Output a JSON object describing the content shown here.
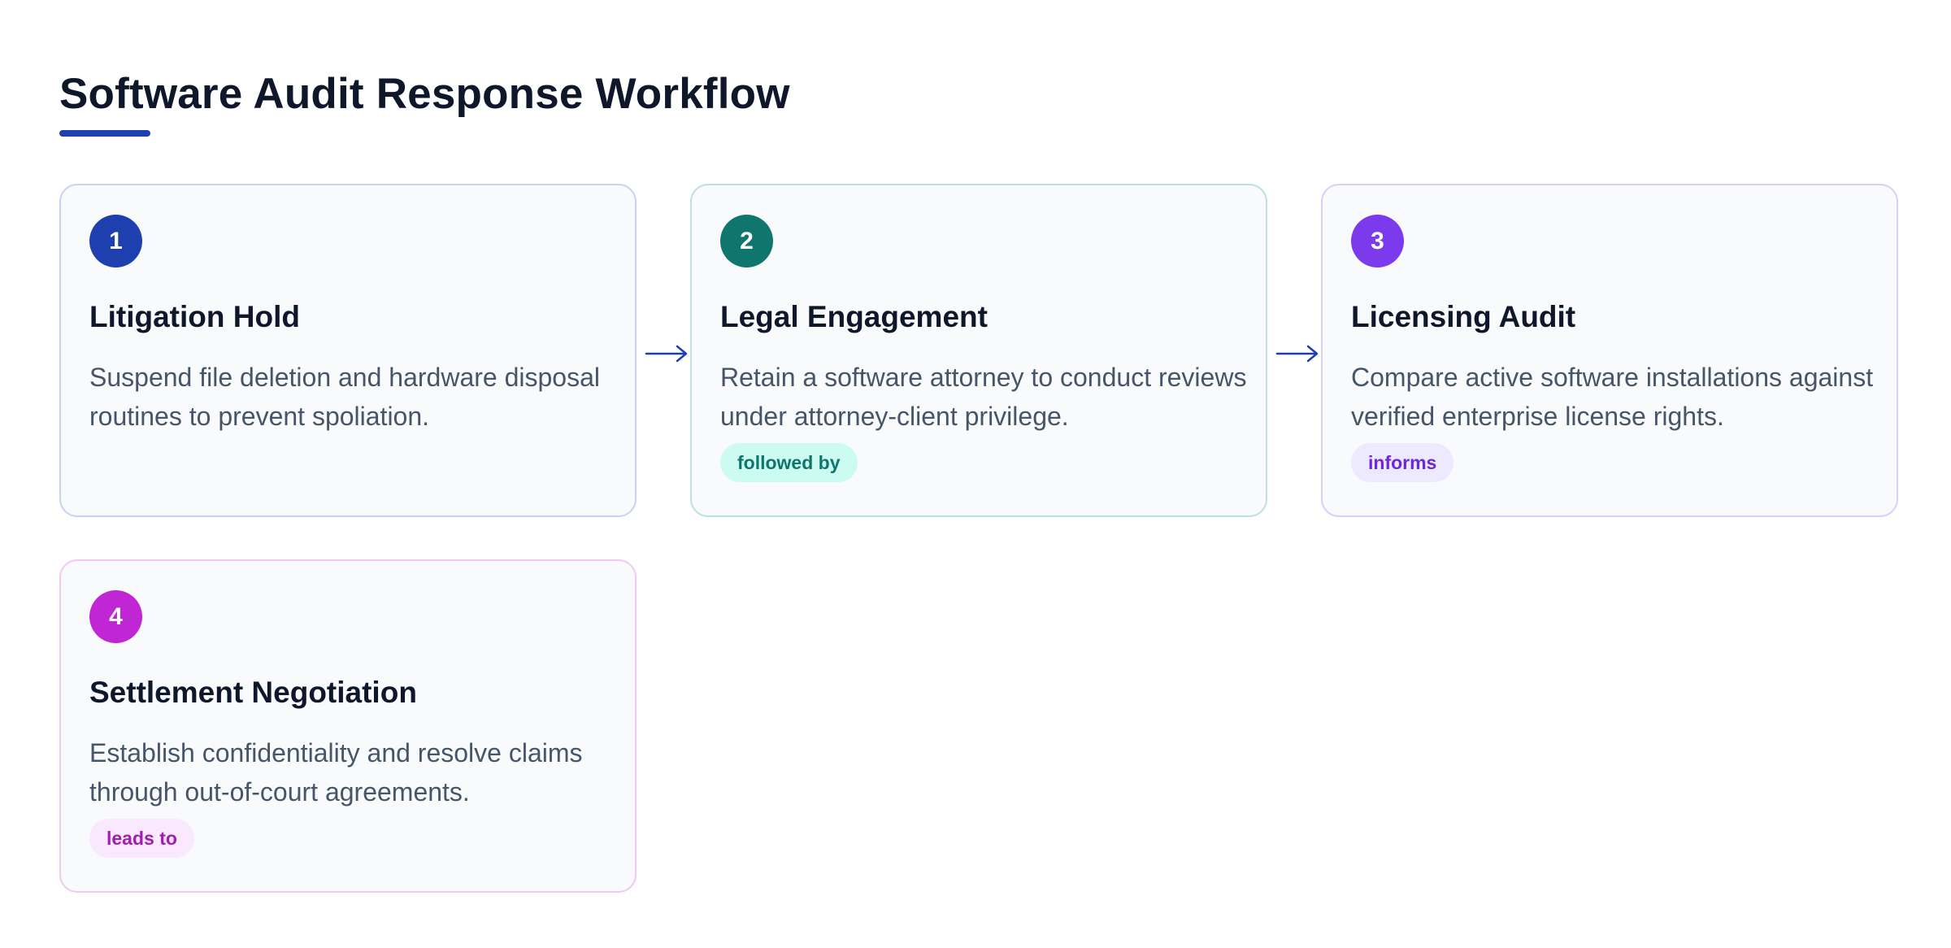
{
  "title": "Software Audit Response Workflow",
  "colors": {
    "title": "#0f172a",
    "accent": "#1e40af",
    "step1": "#1e40af",
    "step2": "#0f766e",
    "step3": "#7c3aed",
    "step4": "#c026d3"
  },
  "steps": [
    {
      "number": "1",
      "title": "Litigation Hold",
      "description": "Suspend file deletion and hardware disposal routines to prevent spoliation."
    },
    {
      "number": "2",
      "title": "Legal Engagement",
      "description": "Retain a software attorney to conduct reviews under attorney-client privilege.",
      "tag": "followed by"
    },
    {
      "number": "3",
      "title": "Licensing Audit",
      "description": "Compare active software installations against verified enterprise license rights.",
      "tag": "informs"
    },
    {
      "number": "4",
      "title": "Settlement Negotiation",
      "description": "Establish confidentiality and resolve claims through out-of-court agreements.",
      "tag": "leads to"
    }
  ],
  "connectors": [
    {
      "from": "1",
      "to": "2",
      "icon": "arrow-right-icon"
    },
    {
      "from": "2",
      "to": "3",
      "icon": "arrow-right-icon"
    }
  ]
}
